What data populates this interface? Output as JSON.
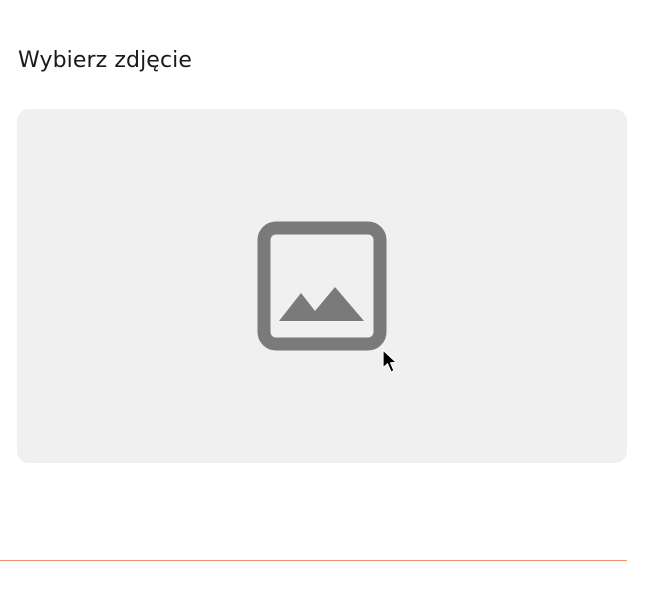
{
  "picker": {
    "title": "Wybierz zdjęcie",
    "dropzone_icon": "image-placeholder-icon"
  },
  "colors": {
    "dropzone_background": "#f0f0f0",
    "icon": "#7a7a7a",
    "divider": "#ef8f6e"
  }
}
